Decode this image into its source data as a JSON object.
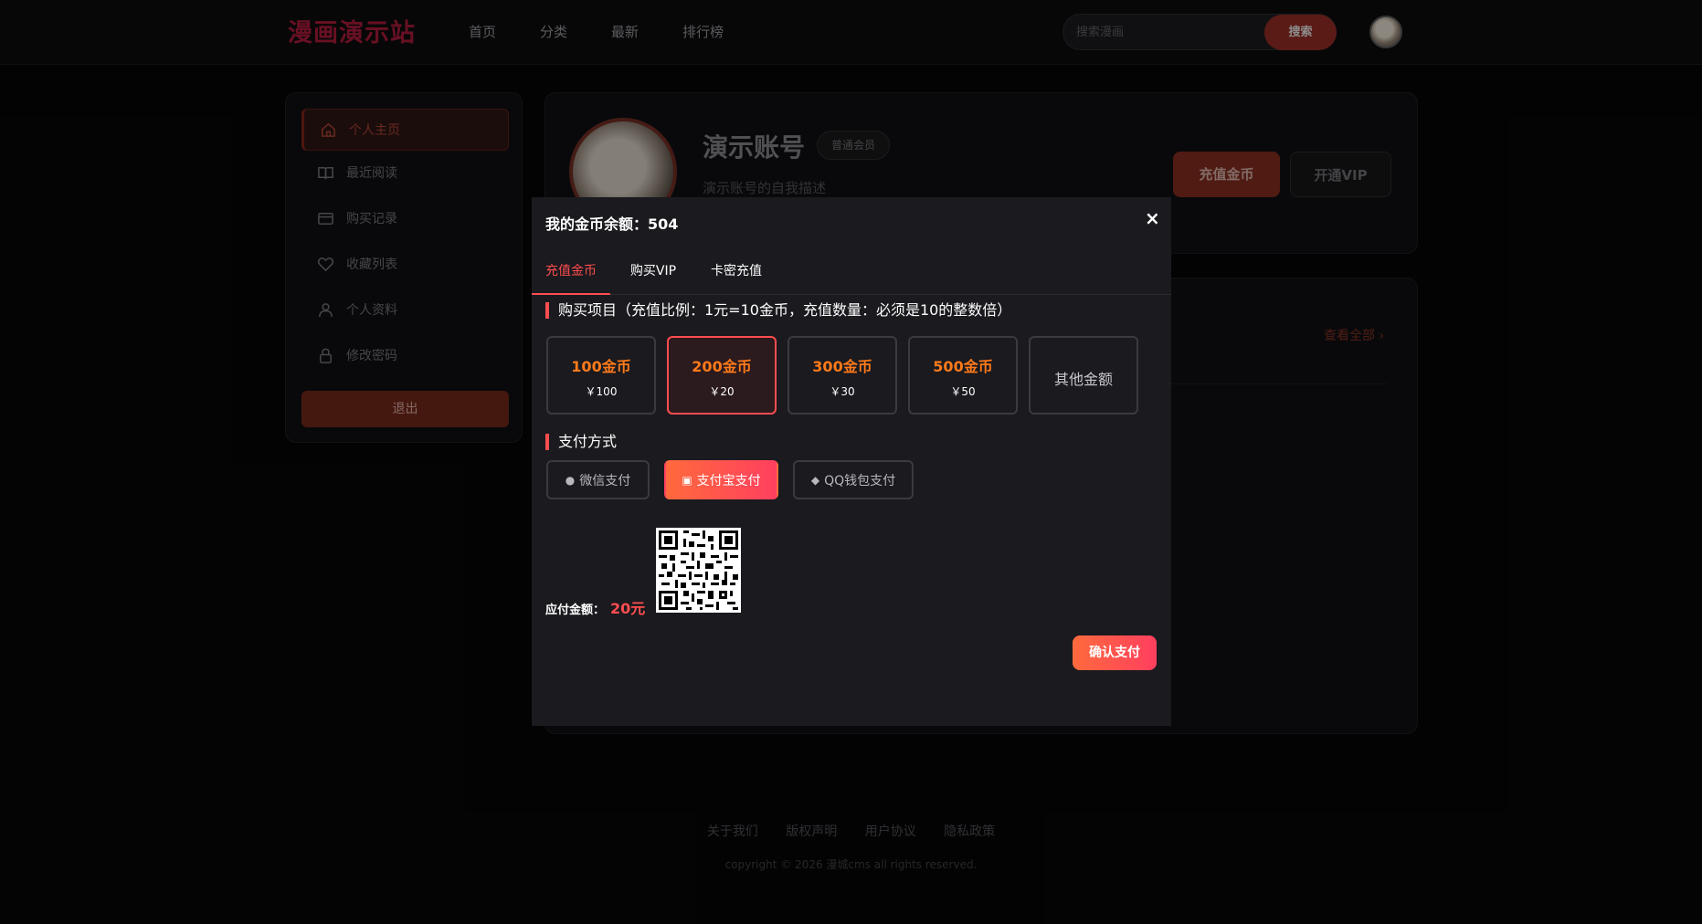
{
  "header": {
    "logo": "漫画演示站",
    "nav": [
      "首页",
      "分类",
      "最新",
      "排行榜"
    ],
    "search_placeholder": "搜索漫画",
    "search_button": "搜索"
  },
  "sidebar": {
    "items": [
      {
        "label": "个人主页",
        "icon": "home-icon"
      },
      {
        "label": "最近阅读",
        "icon": "book-icon"
      },
      {
        "label": "购买记录",
        "icon": "card-icon"
      },
      {
        "label": "收藏列表",
        "icon": "heart-icon"
      },
      {
        "label": "个人资料",
        "icon": "user-icon"
      },
      {
        "label": "修改密码",
        "icon": "lock-icon"
      }
    ],
    "logout": "退出"
  },
  "profile": {
    "name": "演示账号",
    "badge": "普通会员",
    "desc": "演示账号的自我描述",
    "recharge_button": "充值金币",
    "vip_button": "开通VIP"
  },
  "list": {
    "view_all": "查看全部"
  },
  "modal": {
    "title": "我的金币余额：504",
    "close": "×",
    "tabs": [
      "充值金币",
      "购买VIP",
      "卡密充值"
    ],
    "purchase_title": "购买项目（充值比例：1元=10金币，充值数量：必须是10的整数倍）",
    "options": [
      {
        "amount": "100金币",
        "price": "￥100"
      },
      {
        "amount": "200金币",
        "price": "￥20"
      },
      {
        "amount": "300金币",
        "price": "￥30"
      },
      {
        "amount": "500金币",
        "price": "￥50"
      }
    ],
    "other_amount": "其他金额",
    "payment_title": "支付方式",
    "payments": [
      "微信支付",
      "支付宝支付",
      "QQ钱包支付"
    ],
    "amount_label": "应付金额：",
    "amount_value": "20元",
    "confirm": "确认支付"
  },
  "footer": {
    "links": [
      "关于我们",
      "版权声明",
      "用户协议",
      "隐私政策"
    ],
    "copyright": "copyright © 2026 漫城cms all rights reserved."
  },
  "colors": {
    "accent": "#ff4d4f",
    "gold": "#ff7a1a",
    "brand": "#a01a37"
  }
}
